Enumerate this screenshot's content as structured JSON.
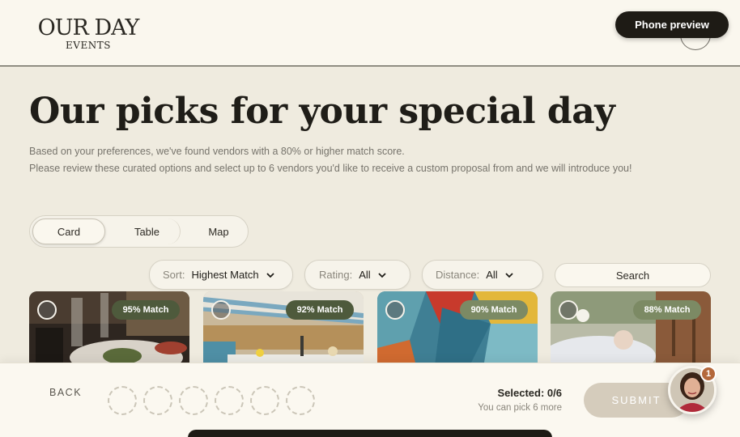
{
  "header": {
    "logo_main": "OUR DAY",
    "logo_sub": "EVENTS",
    "phone_preview_label": "Phone preview"
  },
  "hero": {
    "title": "Our picks for your special day",
    "desc_line1": "Based on your preferences, we've found vendors with a 80% or higher match score.",
    "desc_line2": "Please review these curated options and select up to 6 vendors you'd like to receive a custom proposal from and we will introduce you!"
  },
  "view_tabs": [
    {
      "label": "Card",
      "active": true
    },
    {
      "label": "Table",
      "active": false
    },
    {
      "label": "Map",
      "active": false
    }
  ],
  "filters": {
    "sort": {
      "label": "Sort:",
      "value": "Highest Match"
    },
    "rating": {
      "label": "Rating:",
      "value": "All"
    },
    "distance": {
      "label": "Distance:",
      "value": "All"
    },
    "search_placeholder": "Search"
  },
  "cards": [
    {
      "match": "95% Match",
      "badge_color": "#4e5a3c"
    },
    {
      "match": "92% Match",
      "badge_color": "#4e5a3c"
    },
    {
      "match": "90% Match",
      "badge_color": "#7c8a64"
    },
    {
      "match": "88% Match",
      "badge_color": "#7c8a64"
    }
  ],
  "footer": {
    "back_label": "BACK",
    "selected_label": "Selected: 0/6",
    "pick_more_label": "You can pick 6 more",
    "submit_label": "SUBMIT",
    "notification_count": "1",
    "slot_count": 6
  }
}
